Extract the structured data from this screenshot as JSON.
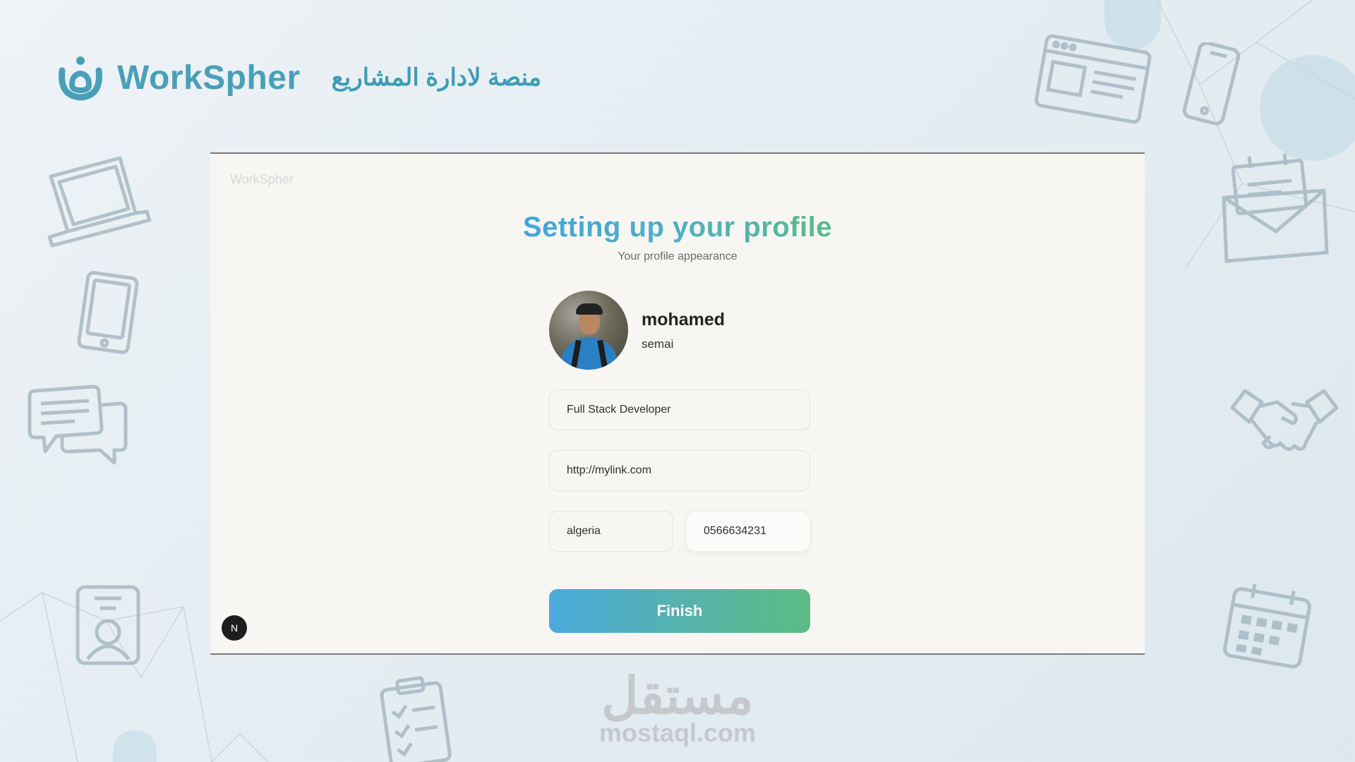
{
  "header": {
    "brand_name": "WorkSpher",
    "tagline": "منصة لادارة المشاريع"
  },
  "card": {
    "ghost_logo": "WorkSpher",
    "title": "Setting up your profile",
    "subtitle": "Your profile appearance",
    "profile": {
      "first_name": "mohamed",
      "last_name": "semai"
    },
    "fields": {
      "role": "Full Stack Developer",
      "link": "http://mylink.com",
      "country": "algeria",
      "phone": "0566634231"
    },
    "finish_label": "Finish",
    "badge_letter": "N"
  },
  "watermark": {
    "arabic": "مستقل",
    "latin": "mostaql.com"
  },
  "colors": {
    "gradient_start": "#41a5dc",
    "gradient_end": "#5bbb8b",
    "brand": "#4a9fb8",
    "card_bg": "#f7f6f3"
  }
}
